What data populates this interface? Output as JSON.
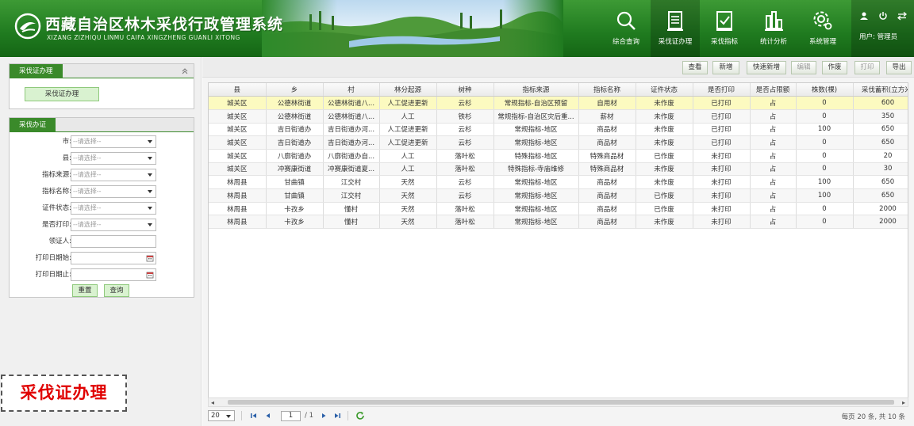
{
  "header": {
    "title": "西藏自治区林木采伐行政管理系统",
    "subtitle": "XIZANG ZIZHIQU LINMU CAIFA XINGZHENG GUANLI XITONG",
    "nav": [
      {
        "label": "综合查询",
        "icon": "search-icon"
      },
      {
        "label": "采伐证办理",
        "icon": "document-icon",
        "active": true
      },
      {
        "label": "采伐指标",
        "icon": "form-icon"
      },
      {
        "label": "统计分析",
        "icon": "chart-icon"
      },
      {
        "label": "系统管理",
        "icon": "gear-icon"
      }
    ],
    "user_label": "用户: 管理员"
  },
  "left": {
    "panel1_title": "采伐证办理",
    "panel1_button": "采伐证办理",
    "panel2_title": "采伐办证",
    "select_placeholder": "--请选择--",
    "fields": [
      {
        "label": "市:",
        "type": "select"
      },
      {
        "label": "县:",
        "type": "select"
      },
      {
        "label": "指标来源:",
        "type": "select"
      },
      {
        "label": "指标名称:",
        "type": "select"
      },
      {
        "label": "证件状态:",
        "type": "select"
      },
      {
        "label": "是否打印:",
        "type": "select"
      },
      {
        "label": "领证人:",
        "type": "input"
      },
      {
        "label": "打印日期始:",
        "type": "date"
      },
      {
        "label": "打印日期止:",
        "type": "date"
      }
    ],
    "reset_label": "重置",
    "query_label": "查询",
    "badge": "采伐证办理"
  },
  "toolbar": {
    "buttons": [
      {
        "label": "查看",
        "enabled": true
      },
      {
        "label": "新增",
        "enabled": true
      },
      {
        "label": "快速新增",
        "enabled": true
      },
      {
        "label": "编辑",
        "enabled": false
      },
      {
        "label": "作废",
        "enabled": true
      },
      {
        "label": "打印",
        "enabled": false
      },
      {
        "label": "导出",
        "enabled": true
      }
    ]
  },
  "table": {
    "columns": [
      "县",
      "乡",
      "村",
      "林分起源",
      "树种",
      "指标来源",
      "指标名称",
      "证件状态",
      "是否打印",
      "是否占限额",
      "株数(棵)",
      "采伐蓄积(立方米)"
    ],
    "rows": [
      [
        "城关区",
        "公德林街道",
        "公德林街道八...",
        "人工促进更新",
        "云杉",
        "常规指标-自治区预留",
        "自用材",
        "未作废",
        "已打印",
        "占",
        "0",
        "600"
      ],
      [
        "城关区",
        "公德林街道",
        "公德林街道八...",
        "人工",
        "铁杉",
        "常规指标-自治区灾后重...",
        "薪材",
        "未作废",
        "已打印",
        "占",
        "0",
        "350"
      ],
      [
        "城关区",
        "吉日街道办",
        "吉日街道办河...",
        "人工促进更新",
        "云杉",
        "常规指标-地区",
        "商品材",
        "未作废",
        "已打印",
        "占",
        "100",
        "650"
      ],
      [
        "城关区",
        "吉日街道办",
        "吉日街道办河...",
        "人工促进更新",
        "云杉",
        "常规指标-地区",
        "商品材",
        "未作废",
        "已打印",
        "占",
        "0",
        "650"
      ],
      [
        "城关区",
        "八廓街道办",
        "八廓街道办自...",
        "人工",
        "落叶松",
        "特殊指标-地区",
        "特殊商品材",
        "已作废",
        "未打印",
        "占",
        "0",
        "20"
      ],
      [
        "城关区",
        "冲赛康街道",
        "冲赛康街道夏...",
        "人工",
        "落叶松",
        "特殊指标-寺庙维修",
        "特殊商品材",
        "未作废",
        "未打印",
        "占",
        "0",
        "30"
      ],
      [
        "林周县",
        "甘曲镇",
        "江交村",
        "天然",
        "云杉",
        "常规指标-地区",
        "商品材",
        "未作废",
        "未打印",
        "占",
        "100",
        "650"
      ],
      [
        "林周县",
        "甘曲镇",
        "江交村",
        "天然",
        "云杉",
        "常规指标-地区",
        "商品材",
        "已作废",
        "未打印",
        "占",
        "100",
        "650"
      ],
      [
        "林周县",
        "卡孜乡",
        "懂村",
        "天然",
        "落叶松",
        "常规指标-地区",
        "商品材",
        "已作废",
        "未打印",
        "占",
        "0",
        "2000"
      ],
      [
        "林周县",
        "卡孜乡",
        "懂村",
        "天然",
        "落叶松",
        "常规指标-地区",
        "商品材",
        "未作废",
        "未打印",
        "占",
        "0",
        "2000"
      ]
    ]
  },
  "pager": {
    "page_size": "20",
    "current_page": "1",
    "total_pages": "/ 1",
    "summary": "每页 20 条, 共 10 条"
  },
  "colors": {
    "brand_green": "#2d8a2a",
    "selected_row": "#fcfac0"
  }
}
